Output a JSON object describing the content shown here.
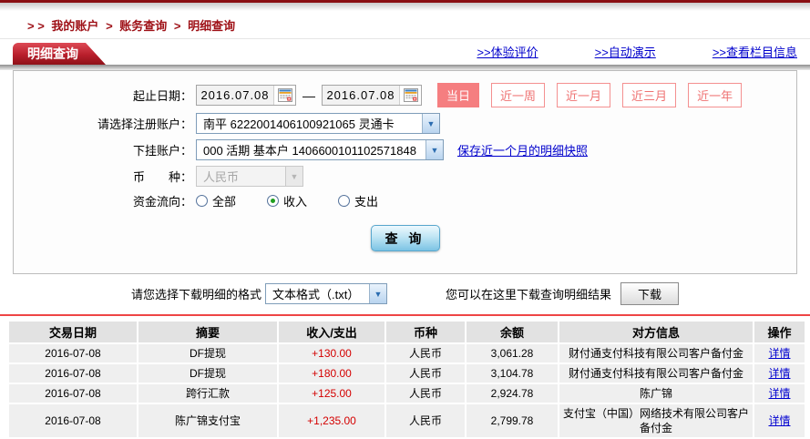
{
  "page": {
    "breadcrumb": {
      "prefix": "> >",
      "separator": ">",
      "items": [
        "我的账户",
        "账务查询",
        "明细查询"
      ]
    },
    "tab_title": "明细查询",
    "top_links": [
      ">>体验评价",
      ">>自动演示",
      ">>查看栏目信息"
    ]
  },
  "form": {
    "date_label": "起止日期：",
    "date_start": "2016.07.08",
    "date_end": "2016.07.08",
    "date_separator": "—",
    "quick_ranges": [
      "当日",
      "近一周",
      "近一月",
      "近三月",
      "近一年"
    ],
    "quick_range_selected": "当日",
    "registered_account_label": "请选择注册账户：",
    "registered_account_value": "南平  6222001406100921065  灵通卡",
    "sub_account_label": "下挂账户：",
    "sub_account_value": "000  活期  基本户  1406600101102571848",
    "snapshot_link": "保存近一个月的明细快照",
    "currency_label": "币　　种：",
    "currency_value": "人民币",
    "flow_label": "资金流向：",
    "flow_options": [
      "全部",
      "收入",
      "支出"
    ],
    "flow_selected": "收入",
    "query_button": "查 询"
  },
  "download": {
    "format_label": "请您选择下载明细的格式",
    "format_value": "文本格式（.txt）",
    "hint": "您可以在这里下载查询明细结果",
    "button": "下载"
  },
  "table": {
    "headers": [
      "交易日期",
      "摘要",
      "收入/支出",
      "币种",
      "余额",
      "对方信息",
      "操作"
    ],
    "rows": [
      {
        "date": "2016-07-08",
        "summary": "DF提现",
        "amount": "+130.00",
        "currency": "人民币",
        "balance": "3,061.28",
        "counterparty": "财付通支付科技有限公司客户备付金",
        "action": "详情"
      },
      {
        "date": "2016-07-08",
        "summary": "DF提现",
        "amount": "+180.00",
        "currency": "人民币",
        "balance": "3,104.78",
        "counterparty": "财付通支付科技有限公司客户备付金",
        "action": "详情"
      },
      {
        "date": "2016-07-08",
        "summary": "跨行汇款",
        "amount": "+125.00",
        "currency": "人民币",
        "balance": "2,924.78",
        "counterparty": "陈广锦",
        "action": "详情"
      },
      {
        "date": "2016-07-08",
        "summary": "陈广锦支付宝",
        "amount": "+1,235.00",
        "currency": "人民币",
        "balance": "2,799.78",
        "counterparty": "支付宝（中国）网络技术有限公司客户备付金",
        "action": "详情"
      }
    ]
  },
  "colors": {
    "brand_red": "#9e1420",
    "link_blue": "#0000cc",
    "amount_red": "#d40000",
    "range_pink": "#f57e80",
    "divider_red": "#ee4545"
  }
}
